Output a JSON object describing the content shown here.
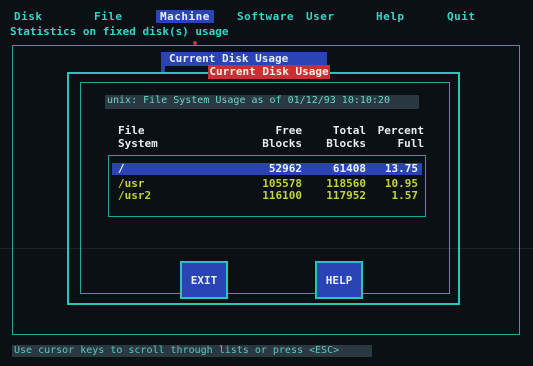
{
  "menu": {
    "items": [
      "Disk",
      "File",
      "Machine",
      "Software",
      "User",
      "Help",
      "Quit"
    ],
    "active": "Machine"
  },
  "status_line": "Statistics on fixed disk(s) usage",
  "tabs": {
    "back": "Current Disk Usage",
    "front": "Current Disk Usage"
  },
  "path_bar": "unix: File System Usage as of 01/12/93 10:10:20",
  "table": {
    "headers": {
      "fs": [
        "File",
        "System"
      ],
      "free": [
        "Free",
        "Blocks"
      ],
      "total": [
        "Total",
        "Blocks"
      ],
      "percent": [
        "Percent",
        "Full"
      ]
    },
    "rows": [
      {
        "fs": "/",
        "free": "52962",
        "total": "61408",
        "percent": "13.75",
        "selected": true
      },
      {
        "fs": "/usr",
        "free": "105578",
        "total": "118560",
        "percent": "10.95",
        "selected": false
      },
      {
        "fs": "/usr2",
        "free": "116100",
        "total": "117952",
        "percent": "1.57",
        "selected": false
      }
    ]
  },
  "buttons": {
    "exit": "EXIT",
    "help": "HELP"
  },
  "bottom_hint": "Use cursor keys to scroll through lists or press <ESC>",
  "colors": {
    "background": "#0b1014",
    "menu_text": "#35d6c8",
    "highlight_blue": "#2a43b5",
    "tab_red": "#c83036",
    "frame_teal": "#2bc4ba",
    "row_text": "#c2d43a"
  }
}
